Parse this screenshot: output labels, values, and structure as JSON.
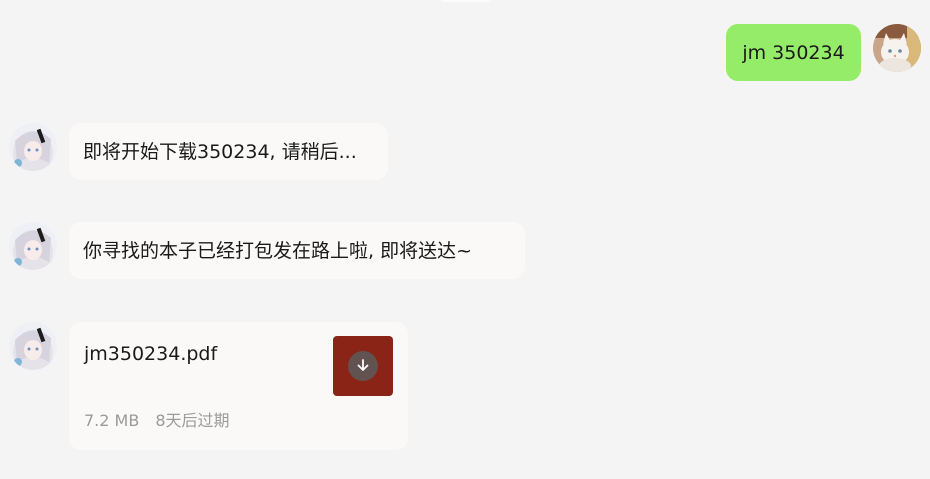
{
  "messages": [
    {
      "side": "out",
      "text": "jm 350234"
    },
    {
      "side": "in",
      "text": "即将开始下载350234, 请稍后..."
    },
    {
      "side": "in",
      "text": "你寻找的本子已经打包发在路上啦, 即将送达~"
    }
  ],
  "file": {
    "name": "jm350234.pdf",
    "size": "7.2 MB",
    "expiry": "8天后过期",
    "icon": "download-icon",
    "icon_bg": "#8a2417"
  },
  "colors": {
    "background": "#f4f4f4",
    "incoming_bubble": "#fbf8f8",
    "outgoing_bubble": "#95ec69",
    "meta_text": "#9b9b9b"
  }
}
